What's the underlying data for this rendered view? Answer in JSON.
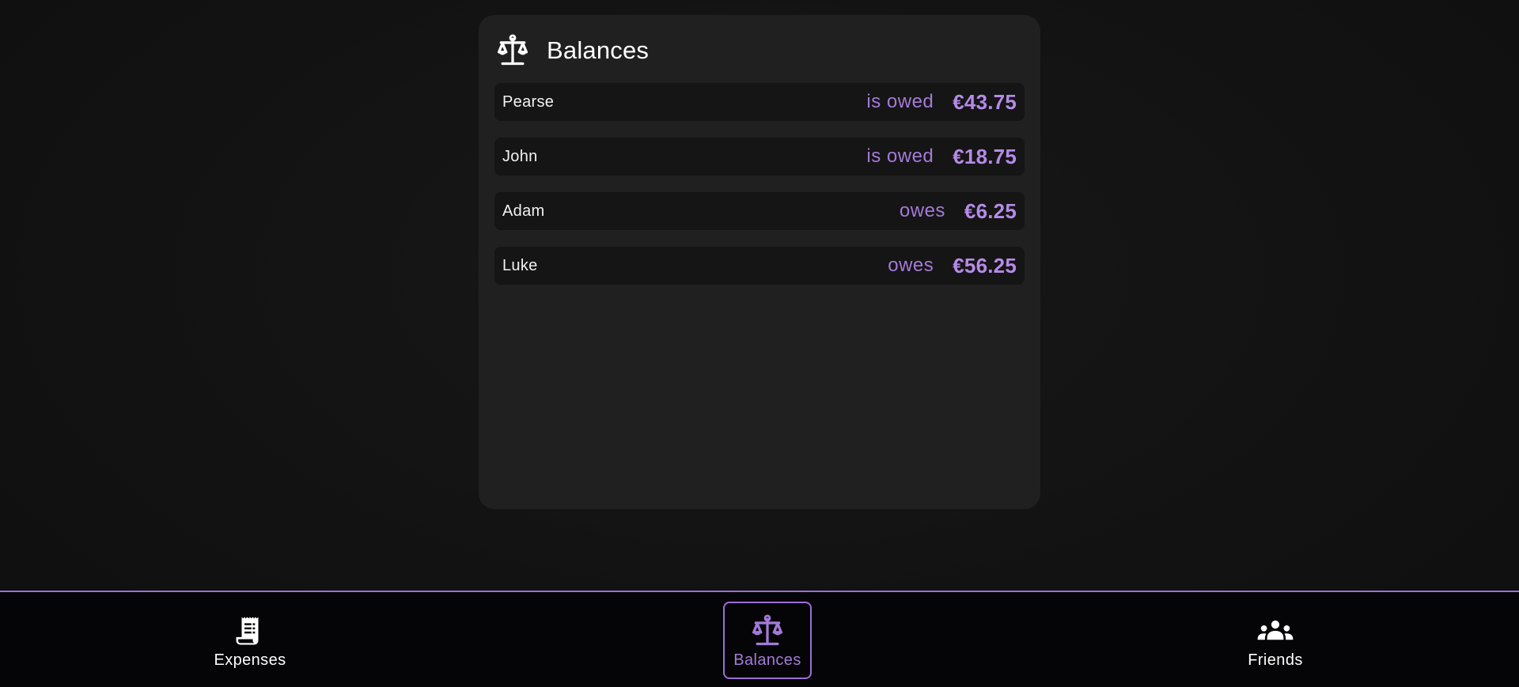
{
  "colors": {
    "accent": "#a47ad8",
    "background": "#121212",
    "card": "#202020",
    "row": "#151515",
    "nav_background": "#050406"
  },
  "balances_card": {
    "title": "Balances",
    "icon": "scale-icon",
    "rows": [
      {
        "name": "Pearse",
        "status": "is owed",
        "amount": "€43.75"
      },
      {
        "name": "John",
        "status": "is owed",
        "amount": "€18.75"
      },
      {
        "name": "Adam",
        "status": "owes",
        "amount": "€6.25"
      },
      {
        "name": "Luke",
        "status": "owes",
        "amount": "€56.25"
      }
    ]
  },
  "nav": {
    "items": [
      {
        "label": "Expenses",
        "icon": "receipt-icon",
        "active": false
      },
      {
        "label": "Balances",
        "icon": "scale-icon",
        "active": true
      },
      {
        "label": "Friends",
        "icon": "group-icon",
        "active": false
      }
    ]
  }
}
